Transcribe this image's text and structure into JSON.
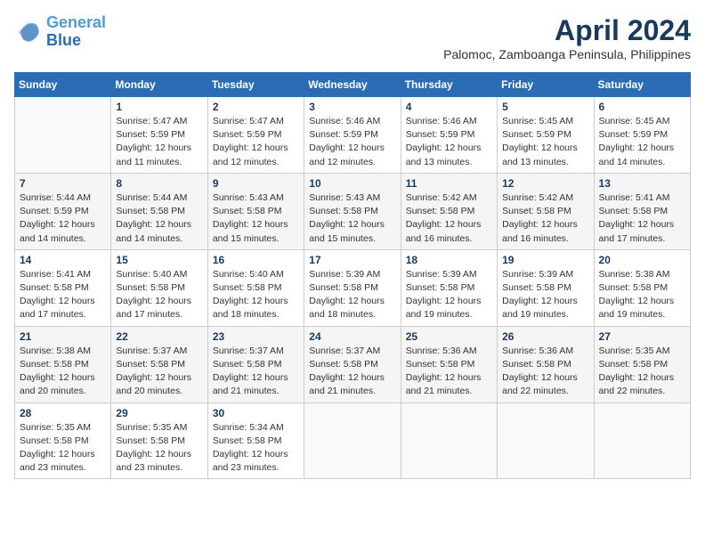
{
  "header": {
    "logo_line1": "General",
    "logo_line2": "Blue",
    "month": "April 2024",
    "location": "Palomoc, Zamboanga Peninsula, Philippines"
  },
  "weekdays": [
    "Sunday",
    "Monday",
    "Tuesday",
    "Wednesday",
    "Thursday",
    "Friday",
    "Saturday"
  ],
  "weeks": [
    [
      {
        "day": "",
        "detail": ""
      },
      {
        "day": "1",
        "detail": "Sunrise: 5:47 AM\nSunset: 5:59 PM\nDaylight: 12 hours\nand 11 minutes."
      },
      {
        "day": "2",
        "detail": "Sunrise: 5:47 AM\nSunset: 5:59 PM\nDaylight: 12 hours\nand 12 minutes."
      },
      {
        "day": "3",
        "detail": "Sunrise: 5:46 AM\nSunset: 5:59 PM\nDaylight: 12 hours\nand 12 minutes."
      },
      {
        "day": "4",
        "detail": "Sunrise: 5:46 AM\nSunset: 5:59 PM\nDaylight: 12 hours\nand 13 minutes."
      },
      {
        "day": "5",
        "detail": "Sunrise: 5:45 AM\nSunset: 5:59 PM\nDaylight: 12 hours\nand 13 minutes."
      },
      {
        "day": "6",
        "detail": "Sunrise: 5:45 AM\nSunset: 5:59 PM\nDaylight: 12 hours\nand 14 minutes."
      }
    ],
    [
      {
        "day": "7",
        "detail": "Sunrise: 5:44 AM\nSunset: 5:59 PM\nDaylight: 12 hours\nand 14 minutes."
      },
      {
        "day": "8",
        "detail": "Sunrise: 5:44 AM\nSunset: 5:58 PM\nDaylight: 12 hours\nand 14 minutes."
      },
      {
        "day": "9",
        "detail": "Sunrise: 5:43 AM\nSunset: 5:58 PM\nDaylight: 12 hours\nand 15 minutes."
      },
      {
        "day": "10",
        "detail": "Sunrise: 5:43 AM\nSunset: 5:58 PM\nDaylight: 12 hours\nand 15 minutes."
      },
      {
        "day": "11",
        "detail": "Sunrise: 5:42 AM\nSunset: 5:58 PM\nDaylight: 12 hours\nand 16 minutes."
      },
      {
        "day": "12",
        "detail": "Sunrise: 5:42 AM\nSunset: 5:58 PM\nDaylight: 12 hours\nand 16 minutes."
      },
      {
        "day": "13",
        "detail": "Sunrise: 5:41 AM\nSunset: 5:58 PM\nDaylight: 12 hours\nand 17 minutes."
      }
    ],
    [
      {
        "day": "14",
        "detail": "Sunrise: 5:41 AM\nSunset: 5:58 PM\nDaylight: 12 hours\nand 17 minutes."
      },
      {
        "day": "15",
        "detail": "Sunrise: 5:40 AM\nSunset: 5:58 PM\nDaylight: 12 hours\nand 17 minutes."
      },
      {
        "day": "16",
        "detail": "Sunrise: 5:40 AM\nSunset: 5:58 PM\nDaylight: 12 hours\nand 18 minutes."
      },
      {
        "day": "17",
        "detail": "Sunrise: 5:39 AM\nSunset: 5:58 PM\nDaylight: 12 hours\nand 18 minutes."
      },
      {
        "day": "18",
        "detail": "Sunrise: 5:39 AM\nSunset: 5:58 PM\nDaylight: 12 hours\nand 19 minutes."
      },
      {
        "day": "19",
        "detail": "Sunrise: 5:39 AM\nSunset: 5:58 PM\nDaylight: 12 hours\nand 19 minutes."
      },
      {
        "day": "20",
        "detail": "Sunrise: 5:38 AM\nSunset: 5:58 PM\nDaylight: 12 hours\nand 19 minutes."
      }
    ],
    [
      {
        "day": "21",
        "detail": "Sunrise: 5:38 AM\nSunset: 5:58 PM\nDaylight: 12 hours\nand 20 minutes."
      },
      {
        "day": "22",
        "detail": "Sunrise: 5:37 AM\nSunset: 5:58 PM\nDaylight: 12 hours\nand 20 minutes."
      },
      {
        "day": "23",
        "detail": "Sunrise: 5:37 AM\nSunset: 5:58 PM\nDaylight: 12 hours\nand 21 minutes."
      },
      {
        "day": "24",
        "detail": "Sunrise: 5:37 AM\nSunset: 5:58 PM\nDaylight: 12 hours\nand 21 minutes."
      },
      {
        "day": "25",
        "detail": "Sunrise: 5:36 AM\nSunset: 5:58 PM\nDaylight: 12 hours\nand 21 minutes."
      },
      {
        "day": "26",
        "detail": "Sunrise: 5:36 AM\nSunset: 5:58 PM\nDaylight: 12 hours\nand 22 minutes."
      },
      {
        "day": "27",
        "detail": "Sunrise: 5:35 AM\nSunset: 5:58 PM\nDaylight: 12 hours\nand 22 minutes."
      }
    ],
    [
      {
        "day": "28",
        "detail": "Sunrise: 5:35 AM\nSunset: 5:58 PM\nDaylight: 12 hours\nand 23 minutes."
      },
      {
        "day": "29",
        "detail": "Sunrise: 5:35 AM\nSunset: 5:58 PM\nDaylight: 12 hours\nand 23 minutes."
      },
      {
        "day": "30",
        "detail": "Sunrise: 5:34 AM\nSunset: 5:58 PM\nDaylight: 12 hours\nand 23 minutes."
      },
      {
        "day": "",
        "detail": ""
      },
      {
        "day": "",
        "detail": ""
      },
      {
        "day": "",
        "detail": ""
      },
      {
        "day": "",
        "detail": ""
      }
    ]
  ]
}
